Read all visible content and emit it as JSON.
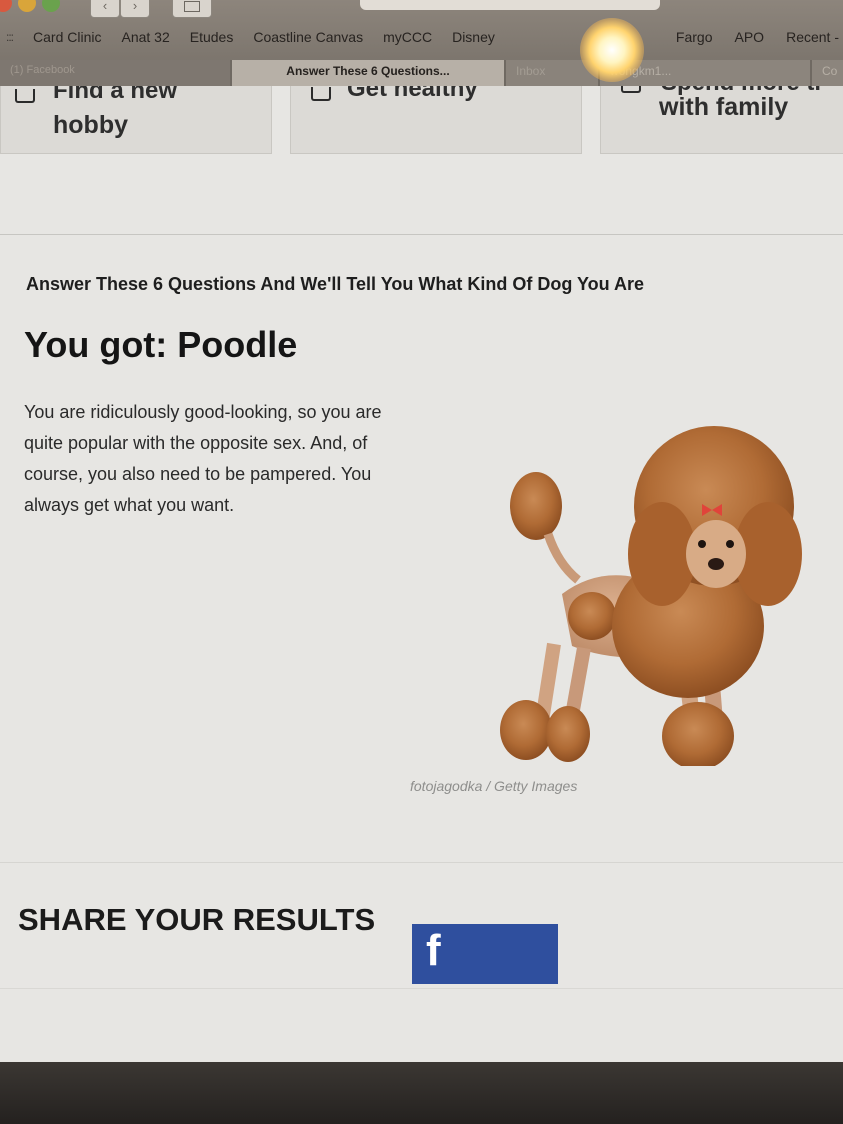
{
  "browser": {
    "bookmarks": [
      "Card Clinic",
      "Anat 32",
      "Etudes",
      "Coastline Canvas",
      "myCCC",
      "Disney"
    ],
    "bookmarks_right": [
      "Fargo",
      "APO",
      "Recent -"
    ],
    "tabs": [
      "(1) Facebook",
      "Answer These 6 Questions...",
      "Inbox",
      "wongkm1...",
      "Co"
    ]
  },
  "cards": [
    {
      "line1": "Find a new",
      "line2": "hobby"
    },
    {
      "line1": "Get healthy"
    },
    {
      "line1": "Spend more ti",
      "line2": "with family"
    }
  ],
  "quiz": {
    "title": "Answer These 6 Questions And We'll Tell You What Kind Of Dog You Are",
    "result_heading": "You got: Poodle",
    "description": "You are ridiculously good-looking, so you are quite popular with the opposite sex. And, of course, you also need to be pampered. You always get what you want.",
    "image_credit": "fotojagodka / Getty Images"
  },
  "share": {
    "title": "SHARE YOUR RESULTS",
    "facebook_glyph": "f"
  },
  "colors": {
    "facebook": "#2f4f9e",
    "page_bg": "#e7e6e3"
  }
}
